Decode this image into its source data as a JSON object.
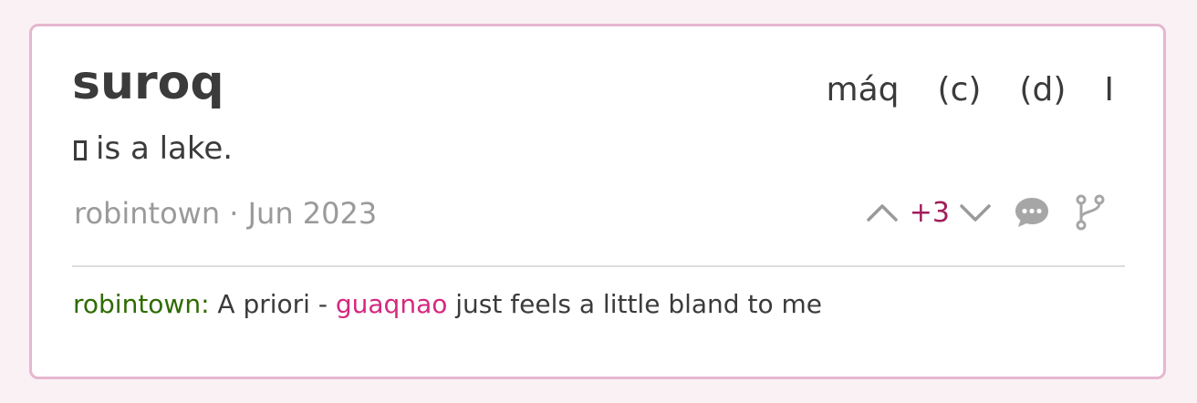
{
  "entry": {
    "word": "suroq",
    "tags": [
      "máq",
      "(c)",
      "(d)",
      "I"
    ],
    "definition": "is a lake.",
    "author": "robintown",
    "separator": "·",
    "date": "Jun 2023",
    "score": "+3"
  },
  "comment": {
    "author": "robintown:",
    "text_before": "A priori -",
    "link_word": "guaqnao",
    "text_after": "just feels a little bland to me"
  },
  "colors": {
    "accent_border": "#e6b7cf",
    "score": "#a01e5a",
    "comment_author": "#2e6b00",
    "link": "#d6287e"
  },
  "icons": [
    "upvote-icon",
    "downvote-icon",
    "comment-icon",
    "fork-icon"
  ]
}
